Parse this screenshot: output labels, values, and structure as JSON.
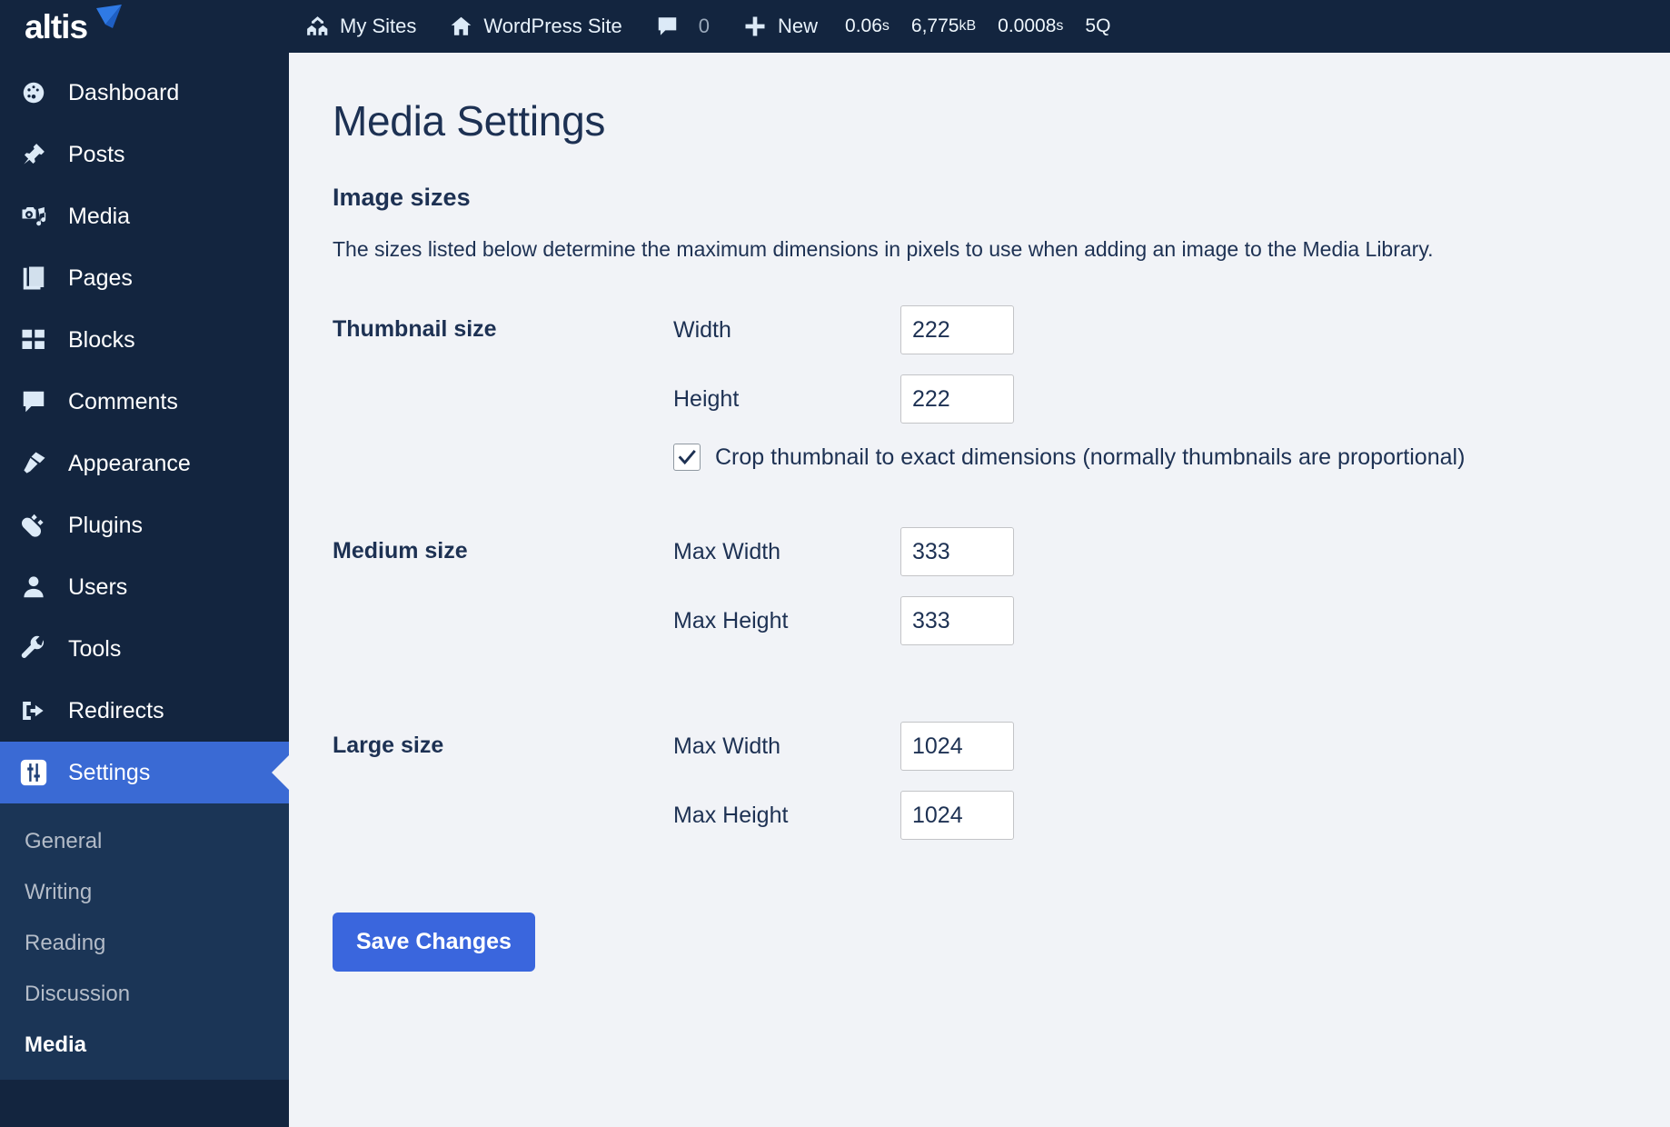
{
  "brand": {
    "name": "altis",
    "logo_icon": "altis-triangle-logo"
  },
  "adminbar": {
    "my_sites": {
      "label": "My Sites",
      "icon": "multisite-houses-icon"
    },
    "site": {
      "label": "WordPress Site",
      "icon": "home-icon"
    },
    "comments": {
      "icon": "comment-bubble-icon",
      "count": "0"
    },
    "new": {
      "label": "New",
      "icon": "plus-icon"
    },
    "stats": [
      {
        "name": "page-generation-time",
        "value": "0.06",
        "unit": "s"
      },
      {
        "name": "memory-usage",
        "value": "6,775",
        "unit": "kB"
      },
      {
        "name": "query-time",
        "value": "0.0008",
        "unit": "s"
      },
      {
        "name": "query-count",
        "value": "5",
        "unit": "Q"
      }
    ]
  },
  "sidebar": {
    "items": [
      {
        "label": "Dashboard",
        "icon": "dashboard-gauge-icon",
        "active": false
      },
      {
        "label": "Posts",
        "icon": "pin-icon",
        "active": false
      },
      {
        "label": "Media",
        "icon": "media-camera-icon",
        "active": false
      },
      {
        "label": "Pages",
        "icon": "pages-icon",
        "active": false
      },
      {
        "label": "Blocks",
        "icon": "blocks-grid-icon",
        "active": false
      },
      {
        "label": "Comments",
        "icon": "comment-bubble-icon",
        "active": false
      },
      {
        "label": "Appearance",
        "icon": "paintbrush-icon",
        "active": false
      },
      {
        "label": "Plugins",
        "icon": "plug-icon",
        "active": false
      },
      {
        "label": "Users",
        "icon": "user-icon",
        "active": false
      },
      {
        "label": "Tools",
        "icon": "wrench-icon",
        "active": false
      },
      {
        "label": "Redirects",
        "icon": "exit-arrow-icon",
        "active": false
      },
      {
        "label": "Settings",
        "icon": "sliders-icon",
        "active": true
      }
    ],
    "submenu": [
      {
        "label": "General",
        "current": false
      },
      {
        "label": "Writing",
        "current": false
      },
      {
        "label": "Reading",
        "current": false
      },
      {
        "label": "Discussion",
        "current": false
      },
      {
        "label": "Media",
        "current": true
      }
    ]
  },
  "main": {
    "page_title": "Media Settings",
    "section_title": "Image sizes",
    "section_description": "The sizes listed below determine the maximum dimensions in pixels to use when adding an image to the Media Library.",
    "thumbnail": {
      "label": "Thumbnail size",
      "width_label": "Width",
      "width_value": "222",
      "height_label": "Height",
      "height_value": "222",
      "crop_label": "Crop thumbnail to exact dimensions (normally thumbnails are proportional)",
      "crop_checked": true
    },
    "medium": {
      "label": "Medium size",
      "width_label": "Max Width",
      "width_value": "333",
      "height_label": "Max Height",
      "height_value": "333"
    },
    "large": {
      "label": "Large size",
      "width_label": "Max Width",
      "width_value": "1024",
      "height_label": "Max Height",
      "height_value": "1024"
    },
    "save_label": "Save Changes"
  },
  "colors": {
    "sidebar_bg": "#13253f",
    "submenu_bg": "#1b3556",
    "accent": "#3a6ad4",
    "button": "#3a66dd",
    "content_bg": "#f1f3f7",
    "text_dark": "#1d3153"
  }
}
